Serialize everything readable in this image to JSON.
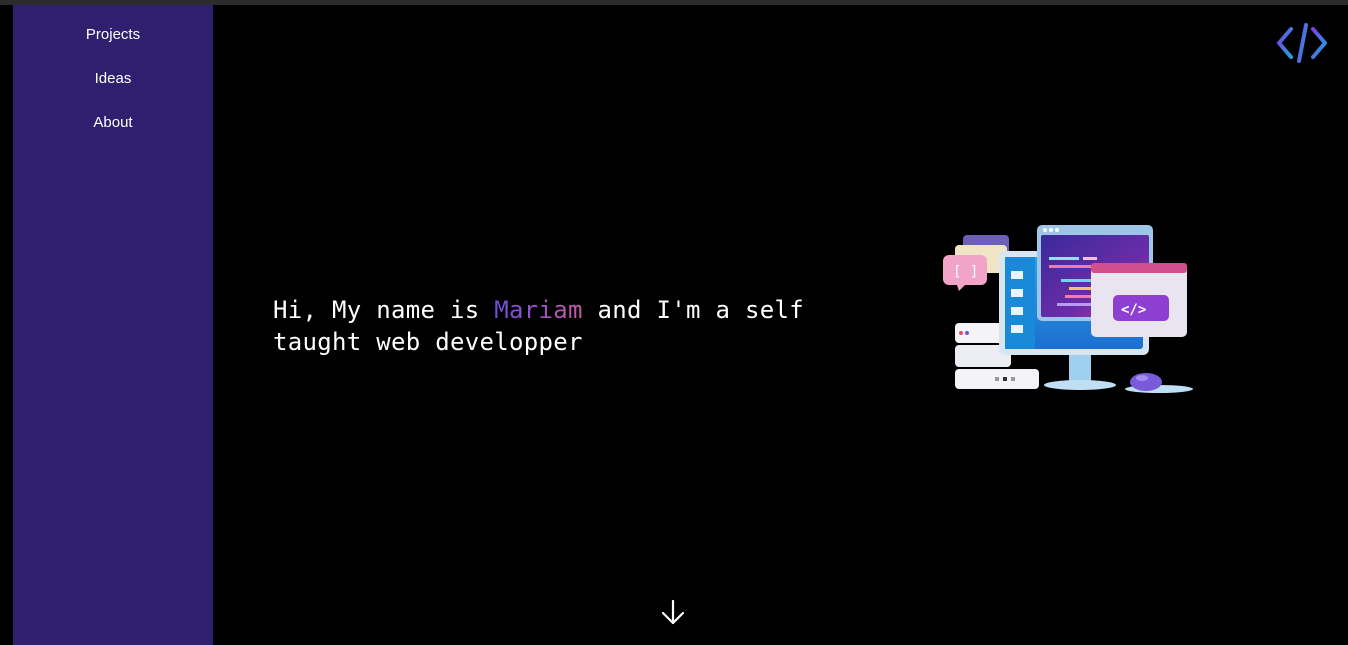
{
  "sidebar": {
    "items": [
      {
        "label": "Projects"
      },
      {
        "label": "Ideas"
      },
      {
        "label": "About"
      }
    ]
  },
  "hero": {
    "intro": "Hi, My name is ",
    "name": "Mariam",
    "rest": " and I'm a self taught web developper"
  },
  "colors": {
    "sidebar": "#2e206e",
    "background": "#000000",
    "name_gradient_start": "#6b4fd8",
    "name_gradient_end": "#c85aa6",
    "logo_start": "#7b3fe4",
    "logo_end": "#1aa7e0"
  },
  "icons": {
    "logo": "code-brackets-icon",
    "illustration": "computer-illustration",
    "scroll": "arrow-down-icon"
  }
}
